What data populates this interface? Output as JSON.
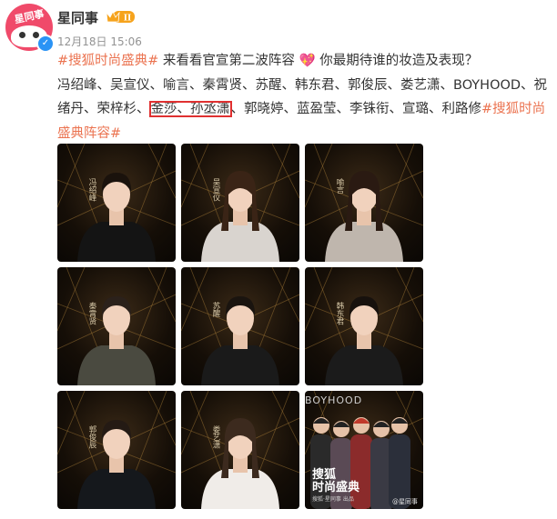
{
  "header": {
    "username": "星同事",
    "avatar_text": "星同事",
    "badge_level": "II",
    "timestamp": "12月18日 15:06"
  },
  "post": {
    "topic_open": "#搜狐时尚盛典#",
    "intro": " 来看看官宣第二波阵容",
    "heart_emoji": "💖",
    "question": " 你最期待谁的妆造及表现？",
    "names_before": "冯绍峰、吴宣仪、喻言、秦霄贤、苏醒、韩东君、郭俊辰、娄艺潇、BOYHOOD、祝绪丹、荣梓杉、",
    "names_highlight": "金莎、孙丞潇",
    "names_after": "、郭晓婷、蓝盈莹、李铢衔、宣璐、利路修",
    "topic_close": "#搜狐时尚盛典阵容#"
  },
  "photos": [
    {
      "name": "冯绍峰",
      "side": "left"
    },
    {
      "name": "吴宣仪",
      "side": "left"
    },
    {
      "name": "喻言",
      "side": "left"
    },
    {
      "name": "秦霄贤",
      "side": "left"
    },
    {
      "name": "苏醒",
      "side": "left"
    },
    {
      "name": "韩东君",
      "side": "left"
    },
    {
      "name": "郭俊辰",
      "side": "left"
    },
    {
      "name": "娄艺潇",
      "side": "left"
    },
    {
      "name": "BOYHOOD",
      "side": "group",
      "sohu": "搜狐\n时尚盛典",
      "sohu_sub": "搜狐·星同事 出品",
      "watermark": "@星同事"
    }
  ],
  "colors": {
    "topic": "#eb7350",
    "highlight_border": "#e03030",
    "verified": "#2a93f5",
    "avatar": "#f04a6a",
    "badge": "#f6a31c"
  }
}
